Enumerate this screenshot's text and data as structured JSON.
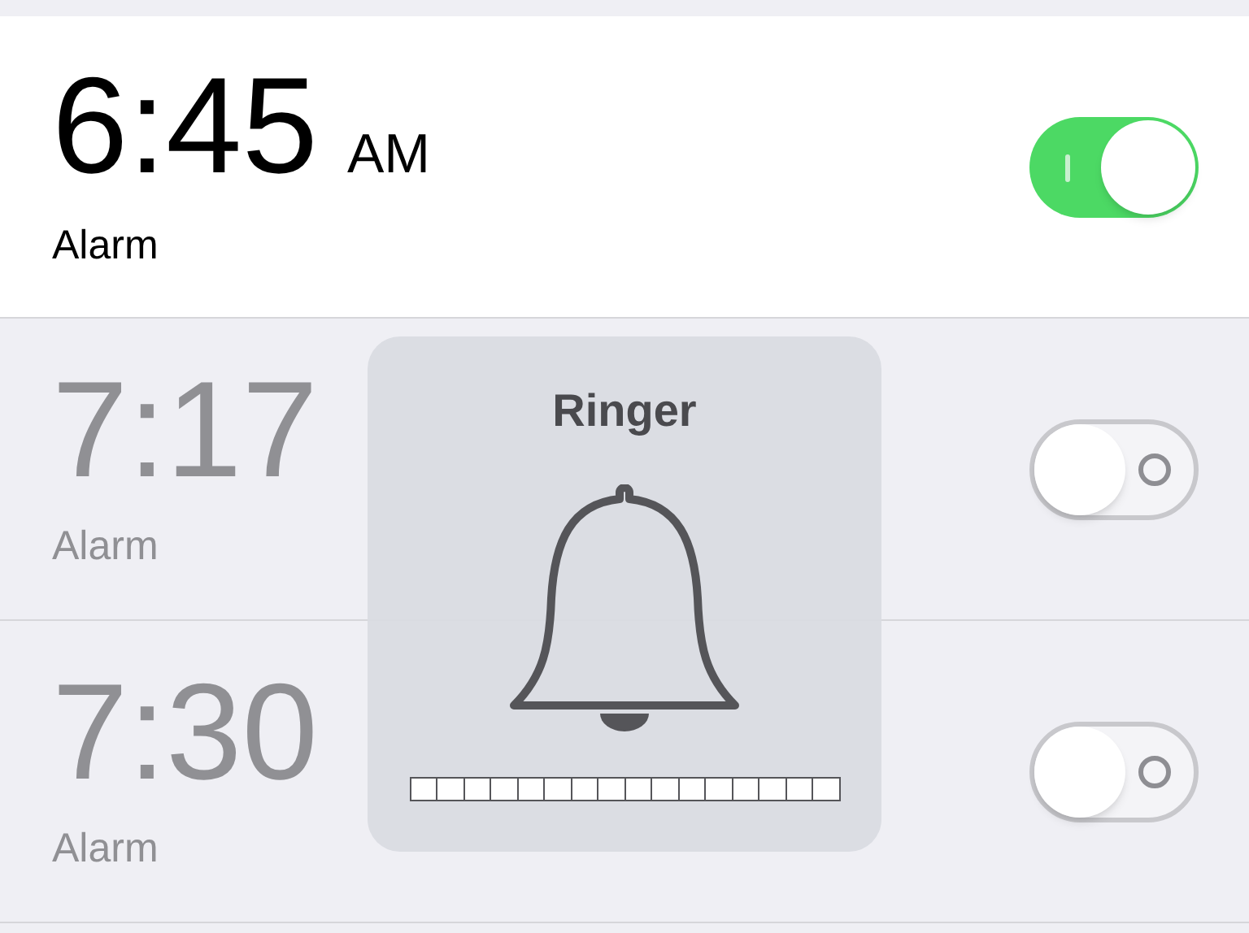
{
  "alarms": [
    {
      "time": "6:45",
      "period": "AM",
      "label": "Alarm",
      "on": true
    },
    {
      "time": "7:17",
      "label": "Alarm",
      "on": false
    },
    {
      "time": "7:30",
      "label": "Alarm",
      "on": false
    }
  ],
  "ringer": {
    "title": "Ringer",
    "level": 0
  }
}
